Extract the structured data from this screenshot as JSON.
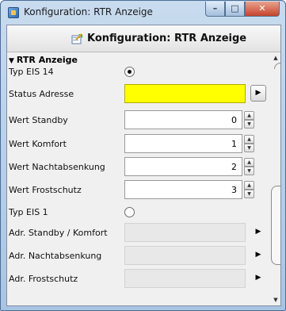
{
  "window": {
    "title": "Konfiguration: RTR Anzeige",
    "minimize_glyph": "–",
    "maximize_glyph": "□",
    "close_glyph": "✕"
  },
  "panel": {
    "title": "Konfiguration: RTR Anzeige",
    "icon": "edit-config-icon"
  },
  "section": {
    "label": "RTR Anzeige",
    "expanded": true
  },
  "rows": [
    {
      "label": "Typ EIS 14",
      "type": "radio",
      "checked": true
    },
    {
      "label": "Status Adresse",
      "type": "address",
      "value": "",
      "highlight": "#ffff00"
    },
    {
      "label": "Wert Standby",
      "type": "spinner",
      "value": "0"
    },
    {
      "label": "Wert Komfort",
      "type": "spinner",
      "value": "1"
    },
    {
      "label": "Wert Nachtabsenkung",
      "type": "spinner",
      "value": "2"
    },
    {
      "label": "Wert Frostschutz",
      "type": "spinner",
      "value": "3"
    },
    {
      "label": "Typ EIS 1",
      "type": "radio",
      "checked": false
    },
    {
      "label": "Adr. Standby / Komfort",
      "type": "address-disabled",
      "value": ""
    },
    {
      "label": "Adr. Nachtabsenkung",
      "type": "address-disabled",
      "value": ""
    },
    {
      "label": "Adr. Frostschutz",
      "type": "address-disabled",
      "value": ""
    }
  ],
  "glyphs": {
    "expand": "▼",
    "arrow_right": "▶",
    "spin_up": "▲",
    "spin_down": "▼",
    "scroll_up": "▲",
    "scroll_down": "▼"
  },
  "colors": {
    "titlebar": "#a9c4e3",
    "close_button": "#c5442c",
    "highlight_field": "#ffff00",
    "panel_bg": "#f0f0f0"
  }
}
